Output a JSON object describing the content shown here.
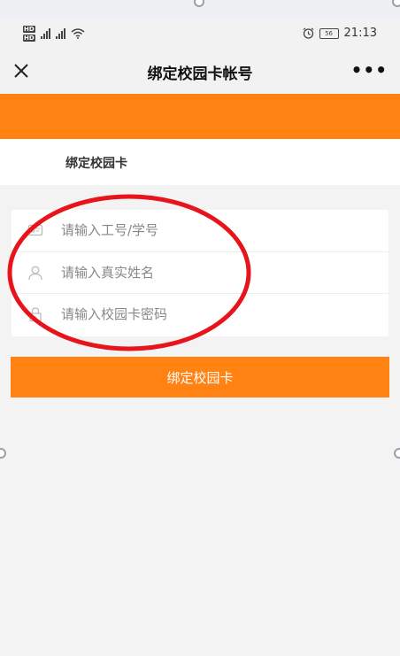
{
  "status_bar": {
    "hd_label_1": "HD",
    "hd_label_2": "HD",
    "time": "21:13",
    "battery_level": "56"
  },
  "nav": {
    "title": "绑定校园卡帐号",
    "close_icon": "close-icon",
    "more_label": "•••"
  },
  "section": {
    "title": "绑定校园卡"
  },
  "form": {
    "fields": [
      {
        "icon": "id-card-icon",
        "placeholder": "请输入工号/学号",
        "value": ""
      },
      {
        "icon": "user-icon",
        "placeholder": "请输入真实姓名",
        "value": ""
      },
      {
        "icon": "lock-icon",
        "placeholder": "请输入校园卡密码",
        "value": ""
      }
    ],
    "submit_label": "绑定校园卡"
  },
  "colors": {
    "accent": "#ff8213",
    "annotation": "#e8141c",
    "background": "#f3f3f3"
  }
}
